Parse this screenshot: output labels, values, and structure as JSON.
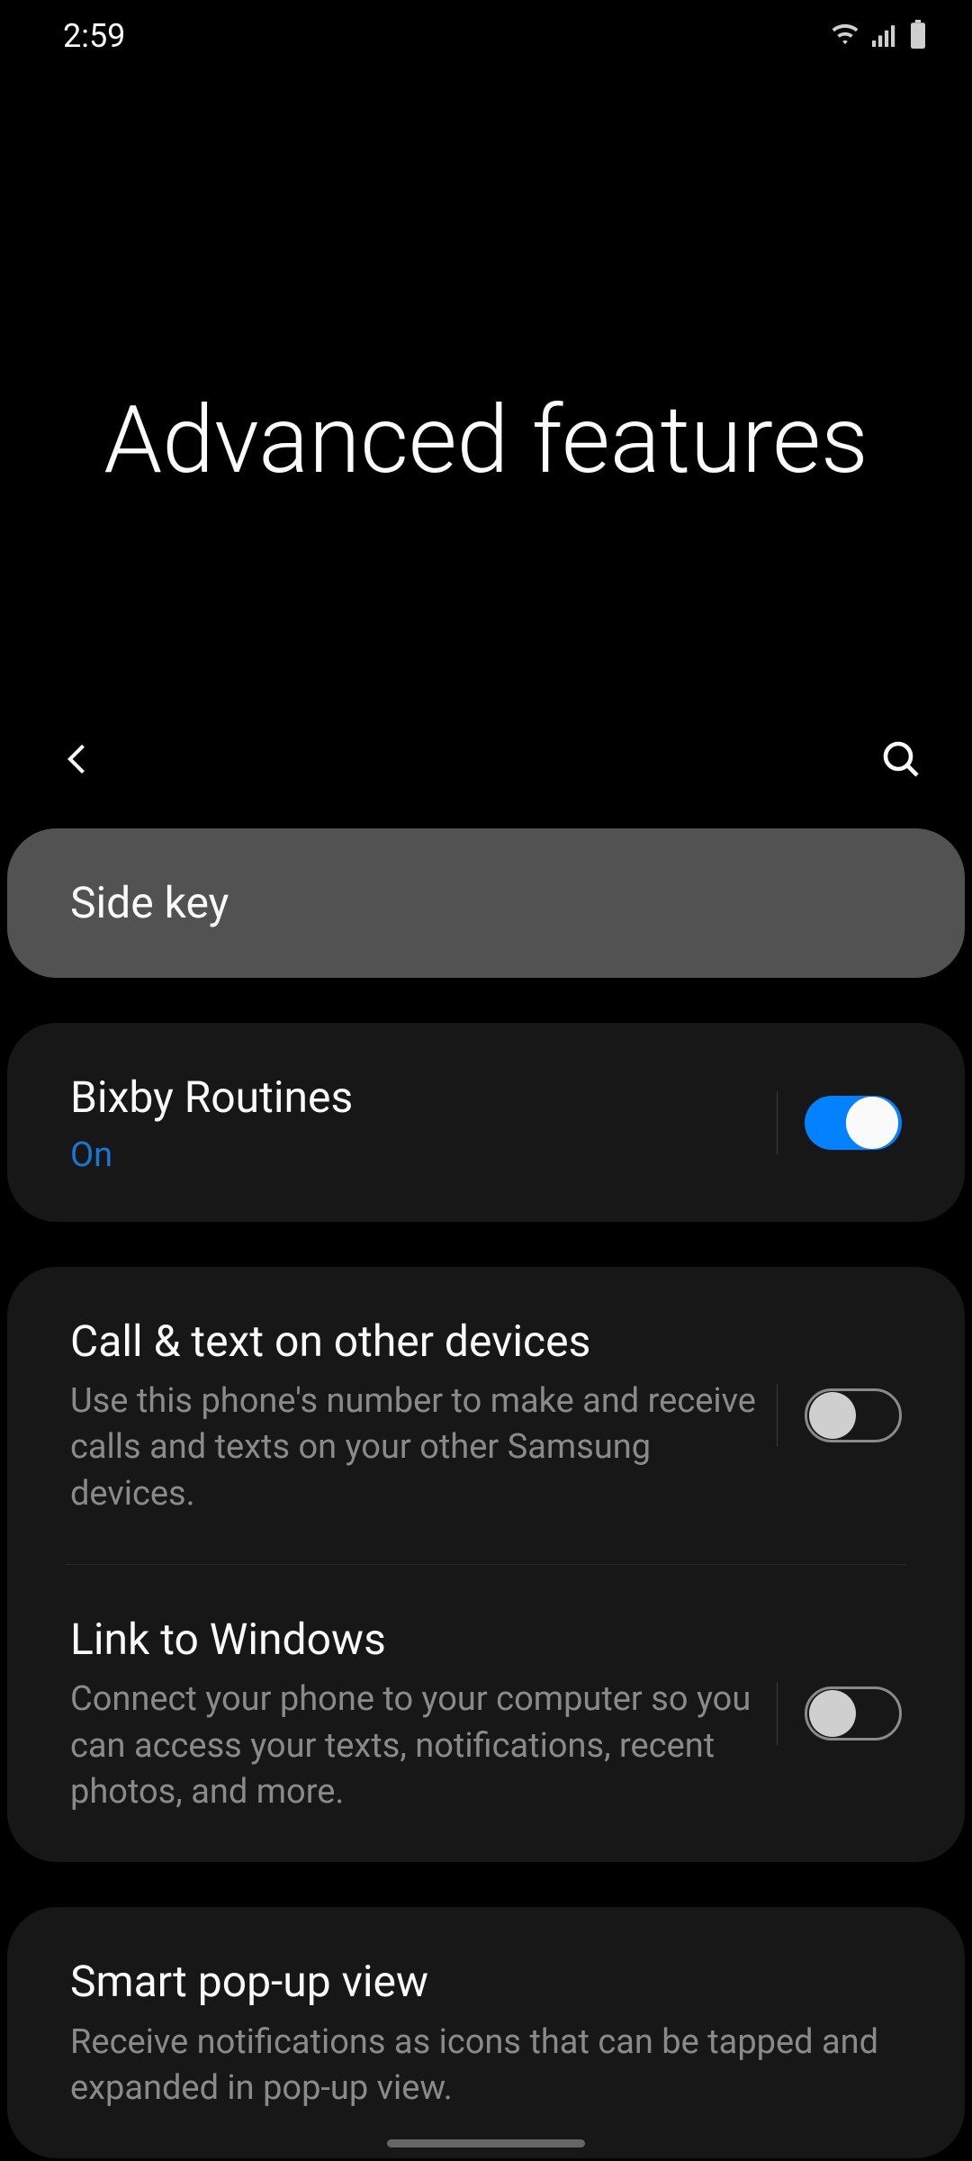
{
  "status": {
    "time": "2:59"
  },
  "header": {
    "title": "Advanced features"
  },
  "groups": [
    {
      "highlighted": true,
      "items": [
        {
          "title": "Side key"
        }
      ]
    },
    {
      "items": [
        {
          "title": "Bixby Routines",
          "status": "On",
          "toggle": true,
          "divider_before_toggle": true
        }
      ]
    },
    {
      "items": [
        {
          "title": "Call & text on other devices",
          "subtitle": "Use this phone's number to make and receive calls and texts on your other Samsung devices.",
          "toggle": false,
          "divider_before_toggle": true
        },
        {
          "title": "Link to Windows",
          "subtitle": "Connect your phone to your computer so you can access your texts, notifications, recent photos, and more.",
          "toggle": false,
          "divider_before_toggle": true
        }
      ]
    },
    {
      "items": [
        {
          "title": "Smart pop-up view",
          "subtitle": "Receive notifications as icons that can be tapped and expanded in pop-up view."
        }
      ]
    }
  ]
}
